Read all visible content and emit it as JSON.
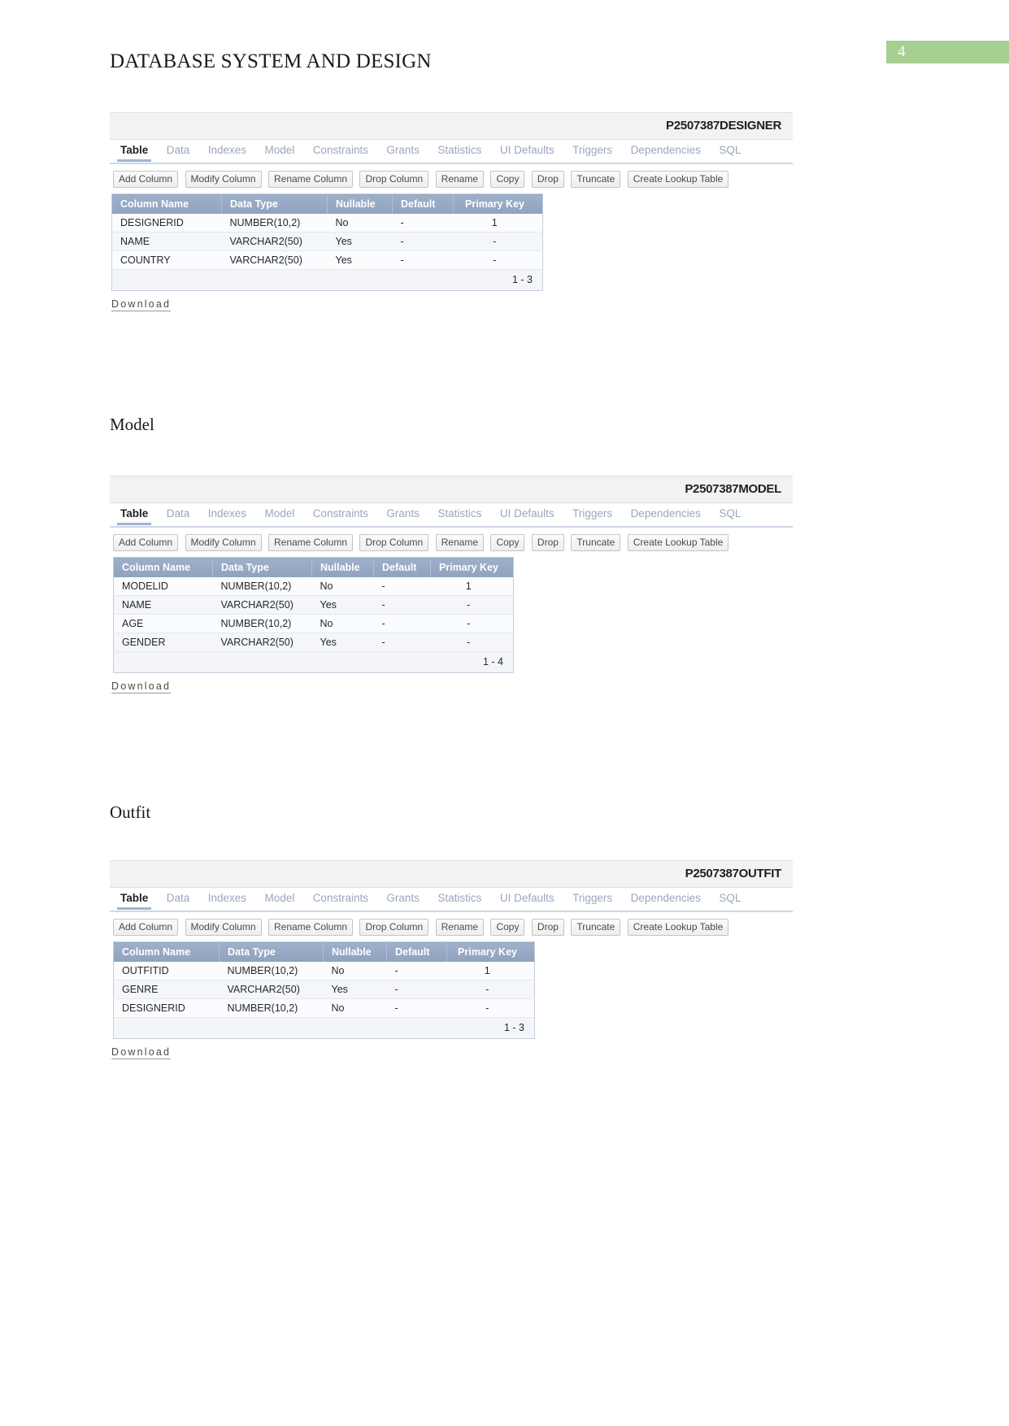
{
  "header": {
    "doc_title": "DATABASE SYSTEM AND DESIGN",
    "page_number": "4",
    "badge_color": "#a8cf92"
  },
  "sections": [
    {
      "heading": "",
      "table_title": "P2507387DESIGNER",
      "tabs": [
        "Table",
        "Data",
        "Indexes",
        "Model",
        "Constraints",
        "Grants",
        "Statistics",
        "UI Defaults",
        "Triggers",
        "Dependencies",
        "SQL"
      ],
      "active_tab": "Table",
      "buttons": [
        "Add Column",
        "Modify Column",
        "Rename Column",
        "Drop Column",
        "Rename",
        "Copy",
        "Drop",
        "Truncate",
        "Create Lookup Table"
      ],
      "columns": [
        "Column Name",
        "Data Type",
        "Nullable",
        "Default",
        "Primary Key"
      ],
      "rows": [
        [
          "DESIGNERID",
          "NUMBER(10,2)",
          "No",
          "-",
          "1"
        ],
        [
          "NAME",
          "VARCHAR2(50)",
          "Yes",
          "-",
          "-"
        ],
        [
          "COUNTRY",
          "VARCHAR2(50)",
          "Yes",
          "-",
          "-"
        ]
      ],
      "row_range": "1 - 3",
      "download_label": "Download"
    },
    {
      "heading": "Model",
      "table_title": "P2507387MODEL",
      "tabs": [
        "Table",
        "Data",
        "Indexes",
        "Model",
        "Constraints",
        "Grants",
        "Statistics",
        "UI Defaults",
        "Triggers",
        "Dependencies",
        "SQL"
      ],
      "active_tab": "Table",
      "buttons": [
        "Add Column",
        "Modify Column",
        "Rename Column",
        "Drop Column",
        "Rename",
        "Copy",
        "Drop",
        "Truncate",
        "Create Lookup Table"
      ],
      "columns": [
        "Column Name",
        "Data Type",
        "Nullable",
        "Default",
        "Primary Key"
      ],
      "rows": [
        [
          "MODELID",
          "NUMBER(10,2)",
          "No",
          "-",
          "1"
        ],
        [
          "NAME",
          "VARCHAR2(50)",
          "Yes",
          "-",
          "-"
        ],
        [
          "AGE",
          "NUMBER(10,2)",
          "No",
          "-",
          "-"
        ],
        [
          "GENDER",
          "VARCHAR2(50)",
          "Yes",
          "-",
          "-"
        ]
      ],
      "row_range": "1 - 4",
      "download_label": "Download"
    },
    {
      "heading": "Outfit",
      "table_title": "P2507387OUTFIT",
      "tabs": [
        "Table",
        "Data",
        "Indexes",
        "Model",
        "Constraints",
        "Grants",
        "Statistics",
        "UI Defaults",
        "Triggers",
        "Dependencies",
        "SQL"
      ],
      "active_tab": "Table",
      "buttons": [
        "Add Column",
        "Modify Column",
        "Rename Column",
        "Drop Column",
        "Rename",
        "Copy",
        "Drop",
        "Truncate",
        "Create Lookup Table"
      ],
      "columns": [
        "Column Name",
        "Data Type",
        "Nullable",
        "Default",
        "Primary Key"
      ],
      "rows": [
        [
          "OUTFITID",
          "NUMBER(10,2)",
          "No",
          "-",
          "1"
        ],
        [
          "GENRE",
          "VARCHAR2(50)",
          "Yes",
          "-",
          "-"
        ],
        [
          "DESIGNERID",
          "NUMBER(10,2)",
          "No",
          "-",
          "-"
        ]
      ],
      "row_range": "1 - 3",
      "download_label": "Download"
    }
  ]
}
